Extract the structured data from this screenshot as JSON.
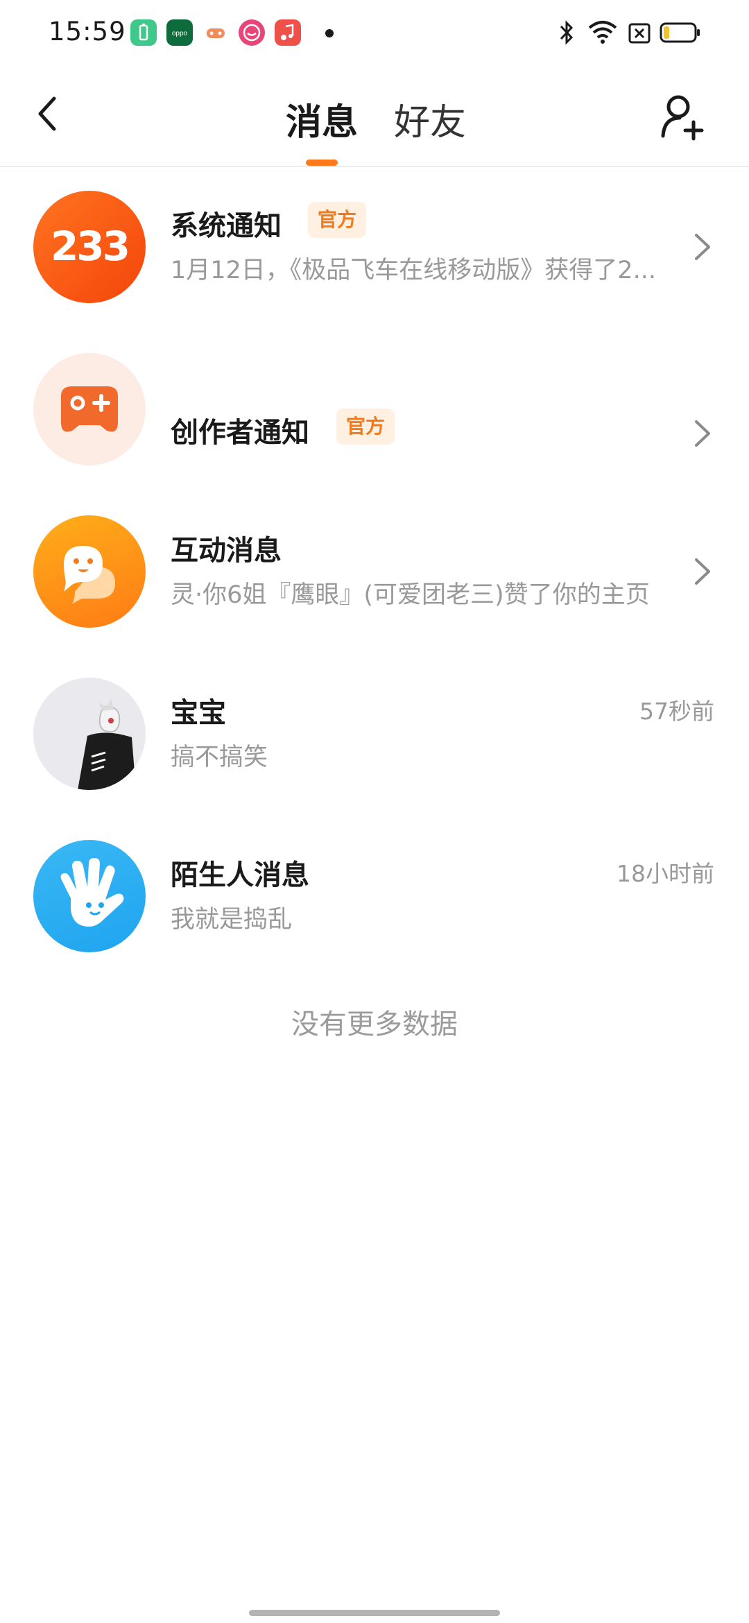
{
  "status_bar": {
    "time": "15:59",
    "notification_icons": [
      "battery-saver-icon",
      "oppo-app-icon",
      "game-icon",
      "music-face-icon",
      "music-note-icon"
    ],
    "system_icons": [
      "bluetooth-icon",
      "wifi-icon",
      "sim-off-icon",
      "battery-icon"
    ]
  },
  "header": {
    "tabs": [
      {
        "label": "消息",
        "active": true
      },
      {
        "label": "好友",
        "active": false
      }
    ],
    "accent_color": "#ff7a1a"
  },
  "messages": [
    {
      "title": "系统通知",
      "badge": "官方",
      "subtitle": "1月12日，《极品飞车在线移动版》获得了2...",
      "time": "",
      "avatar": "233-logo-icon"
    },
    {
      "title": "创作者通知",
      "badge": "官方",
      "subtitle": "",
      "time": "",
      "avatar": "gamepad-icon"
    },
    {
      "title": "互动消息",
      "badge": "",
      "subtitle": "灵·你6姐『鹰眼』(可爱团老三)赞了你的主页",
      "time": "",
      "avatar": "chat-bubble-icon"
    },
    {
      "title": "宝宝",
      "badge": "",
      "subtitle": "搞不搞笑",
      "time": "57秒前",
      "avatar": "user-avatar"
    },
    {
      "title": "陌生人消息",
      "badge": "",
      "subtitle": "我就是捣乱",
      "time": "18小时前",
      "avatar": "waving-hand-icon"
    }
  ],
  "footer": {
    "end_text": "没有更多数据"
  }
}
